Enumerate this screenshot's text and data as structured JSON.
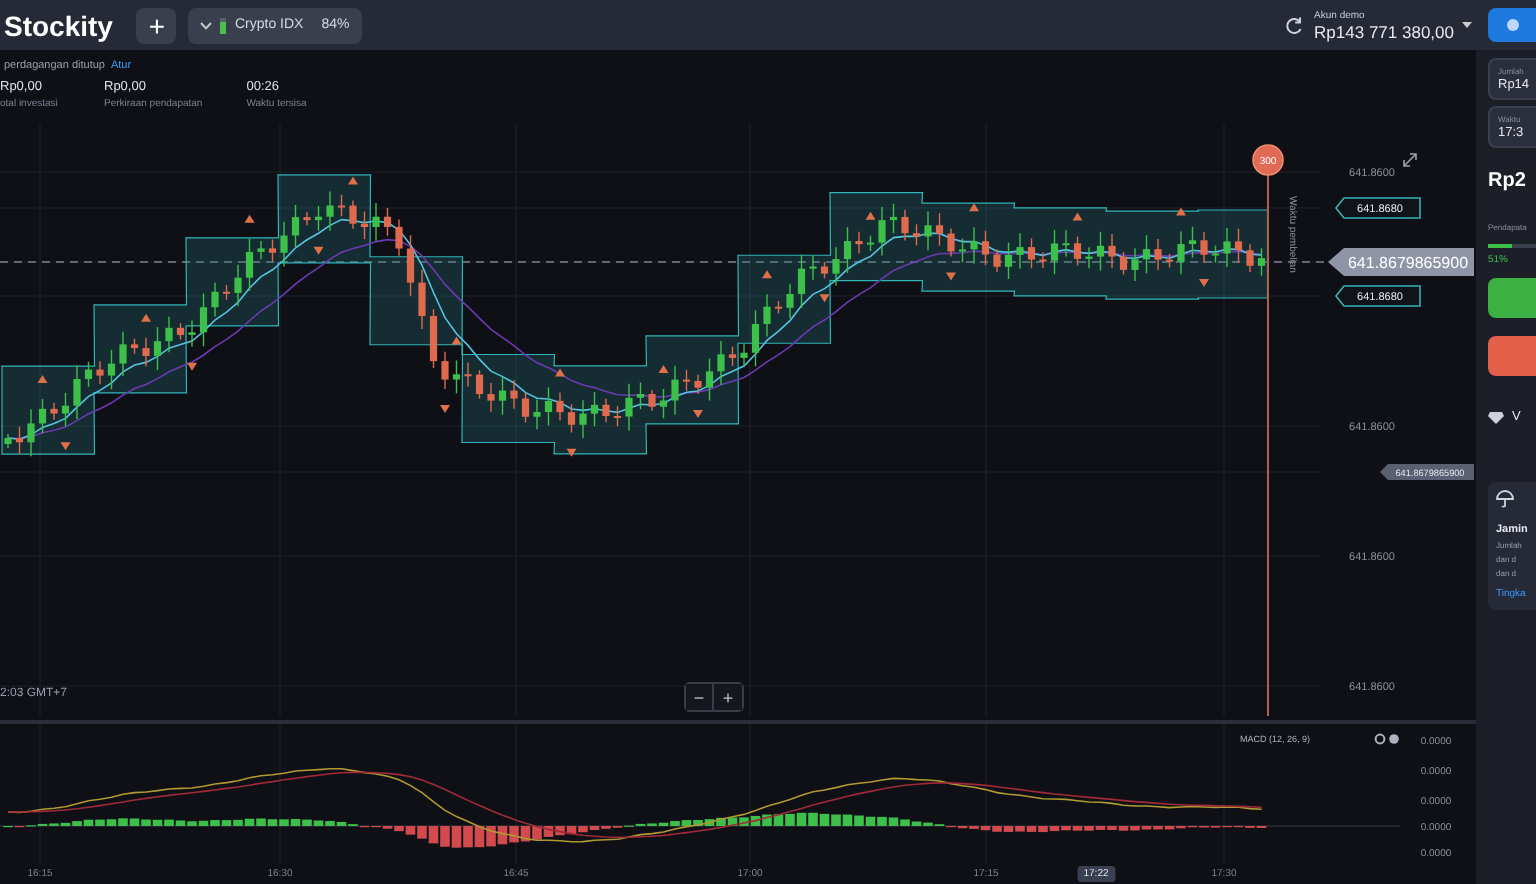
{
  "header": {
    "logo": "Stockity",
    "add_button": "+",
    "asset": {
      "name": "Crypto IDX",
      "payout": "84%"
    },
    "account": {
      "label": "Akun demo",
      "balance": "Rp143 771 380,00"
    }
  },
  "notice": {
    "text": "perdagangan ditutup",
    "link": "Atur"
  },
  "stats": [
    {
      "value": "Rp0,00",
      "label": "otal investasi"
    },
    {
      "value": "Rp0,00",
      "label": "Perkiraan pendapatan"
    },
    {
      "value": "00:26",
      "label": "Waktu tersisa"
    }
  ],
  "chart": {
    "timer": "300",
    "purchase_label": "Waktu pembelian",
    "timezone": "2:03 GMT+7",
    "zoom": [
      "−",
      "+"
    ],
    "price_labels": [
      {
        "text": "641.8600",
        "kind": "plain"
      },
      {
        "text": "641.8680",
        "kind": "tag"
      },
      {
        "text": "641.8679865900",
        "kind": "current"
      },
      {
        "text": "641.8680",
        "kind": "tag"
      },
      {
        "text": "641.8600",
        "kind": "plain"
      },
      {
        "text": "641.8679865900",
        "kind": "small"
      },
      {
        "text": "641.8600",
        "kind": "plain"
      },
      {
        "text": "641.8600",
        "kind": "plain"
      }
    ]
  },
  "macd": {
    "title": "MACD (12, 26, 9)",
    "axis": [
      "0.0000",
      "0.0000",
      "0.0000",
      "0.0000",
      "0.0000"
    ]
  },
  "time_axis": [
    {
      "label": "16:15",
      "selected": false
    },
    {
      "label": "16:30",
      "selected": false
    },
    {
      "label": "16:45",
      "selected": false
    },
    {
      "label": "17:00",
      "selected": false
    },
    {
      "label": "17:15",
      "selected": false
    },
    {
      "label": "17:22",
      "selected": true
    },
    {
      "label": "17:30",
      "selected": false
    }
  ],
  "side": {
    "amount": {
      "label": "Jumlah",
      "value": "Rp14"
    },
    "time": {
      "label": "Waktu",
      "value": "17:3"
    },
    "payout": "Rp2",
    "income_label": "Pendapata",
    "income": {
      "level": 0.51,
      "text": "51%"
    },
    "tier": "V",
    "insurance": {
      "title": "Jamin",
      "lines": [
        "Jumlah",
        "dan d",
        "dan d"
      ],
      "link": "Tingka"
    }
  }
}
